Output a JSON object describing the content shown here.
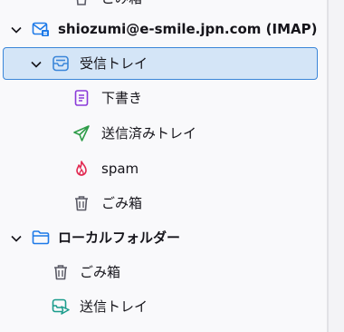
{
  "partial_top": {
    "label": "ごみ箱"
  },
  "account": {
    "label": "shiozumi@e-smile.jpn.com (IMAP)"
  },
  "folders": {
    "inbox": {
      "label": "受信トレイ"
    },
    "drafts": {
      "label": "下書き"
    },
    "sent": {
      "label": "送信済みトレイ"
    },
    "spam": {
      "label": "spam"
    },
    "trash": {
      "label": "ごみ箱"
    }
  },
  "local_folders": {
    "label": "ローカルフォルダー",
    "trash": {
      "label": "ごみ箱"
    },
    "outbox": {
      "label": "送信トレイ"
    }
  },
  "colors": {
    "selection_bg": "#d4e5f7",
    "selection_border": "#3b86d9",
    "account_icon": "#1e7ae8",
    "inbox_icon": "#3b86d9",
    "drafts_icon": "#8a3ad9",
    "sent_icon": "#2e9c48",
    "spam_icon": "#e22850",
    "trash_icon": "#5b5b66",
    "folder_icon": "#1e7ae8",
    "outbox_icon": "#1a9c8c"
  }
}
